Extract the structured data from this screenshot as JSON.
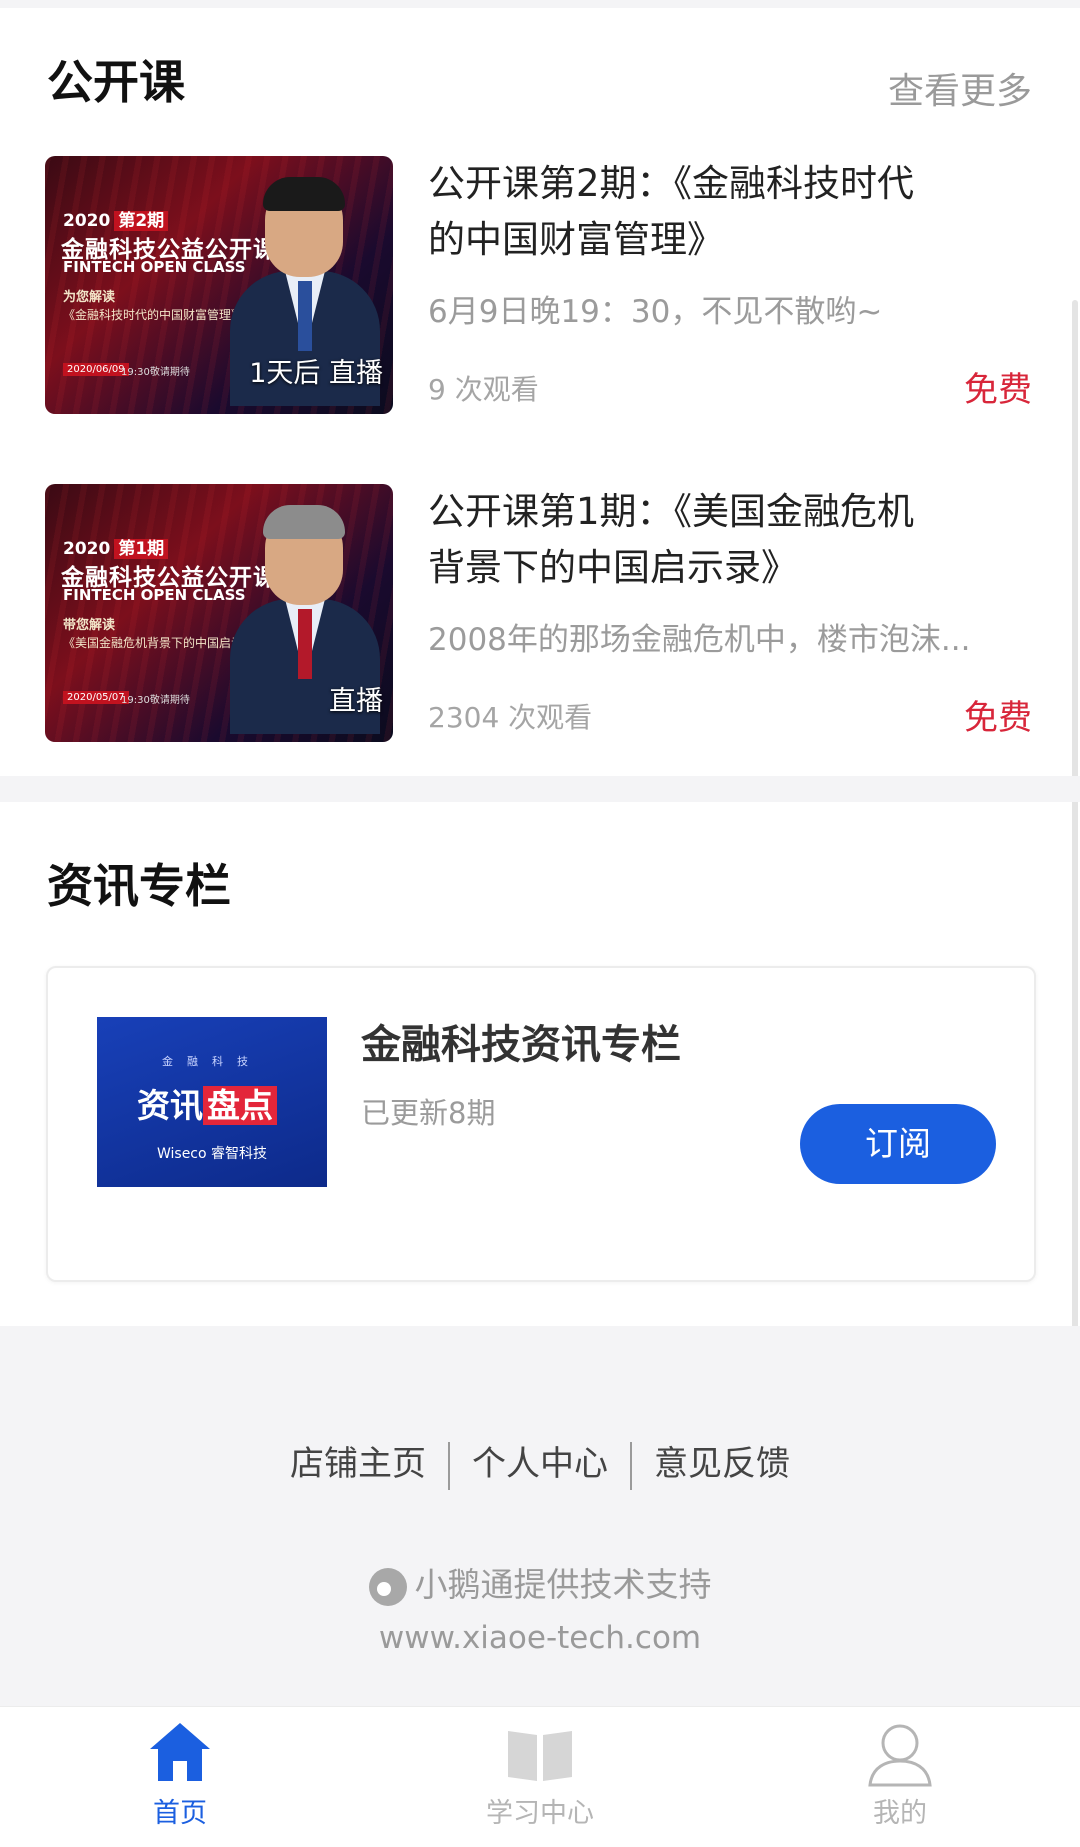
{
  "open_class": {
    "title": "公开课",
    "more": "查看更多",
    "courses": [
      {
        "title": "公开课第2期：《金融科技时代的中国财富管理》",
        "desc": "6月9日晚19：30，不见不散哟~",
        "views": "9 次观看",
        "price": "免费",
        "overlay": "1天后 直播",
        "thumb": {
          "year": "2020",
          "issue": "第2期",
          "brand": "金融科技公益公开课",
          "brand_en": "FINTECH OPEN CLASS",
          "intro": "为您解读",
          "topic": "《金融科技时代的中国财富管理》",
          "date": "2020/06/09",
          "time": "19:30敬请期待"
        }
      },
      {
        "title": "公开课第1期：《美国金融危机背景下的中国启示录》",
        "desc": "2008年的那场金融危机中，楼市泡沫...",
        "views": "2304 次观看",
        "price": "免费",
        "overlay": "直播",
        "thumb": {
          "year": "2020",
          "issue": "第1期",
          "brand": "金融科技公益公开课",
          "brand_en": "FINTECH OPEN CLASS",
          "intro": "带您解读",
          "topic": "《美国金融危机背景下的中国启示录》",
          "date": "2020/05/07",
          "time": "19:30敬请期待"
        }
      }
    ]
  },
  "news_column": {
    "title": "资讯专栏",
    "item": {
      "name": "金融科技资讯专栏",
      "updates": "已更新8期",
      "subscribe": "订阅",
      "thumb_tags": "金融科技",
      "thumb_main_a": "资讯",
      "thumb_main_b": "盘点",
      "thumb_logo": "Wiseco 睿智科技"
    }
  },
  "footer": {
    "links": [
      "店铺主页",
      "个人中心",
      "意见反馈"
    ],
    "support": "小鹅通提供技术支持",
    "url": "www.xiaoe-tech.com"
  },
  "tabbar": {
    "tabs": [
      {
        "label": "首页",
        "icon": "home-icon",
        "active": true
      },
      {
        "label": "学习中心",
        "icon": "book-icon",
        "active": false
      },
      {
        "label": "我的",
        "icon": "user-icon",
        "active": false
      }
    ],
    "active_color": "#1b5fe0",
    "inactive_color": "#b5b5b5"
  },
  "colors": {
    "accent": "#1b5fe0",
    "price": "#d8263a"
  }
}
